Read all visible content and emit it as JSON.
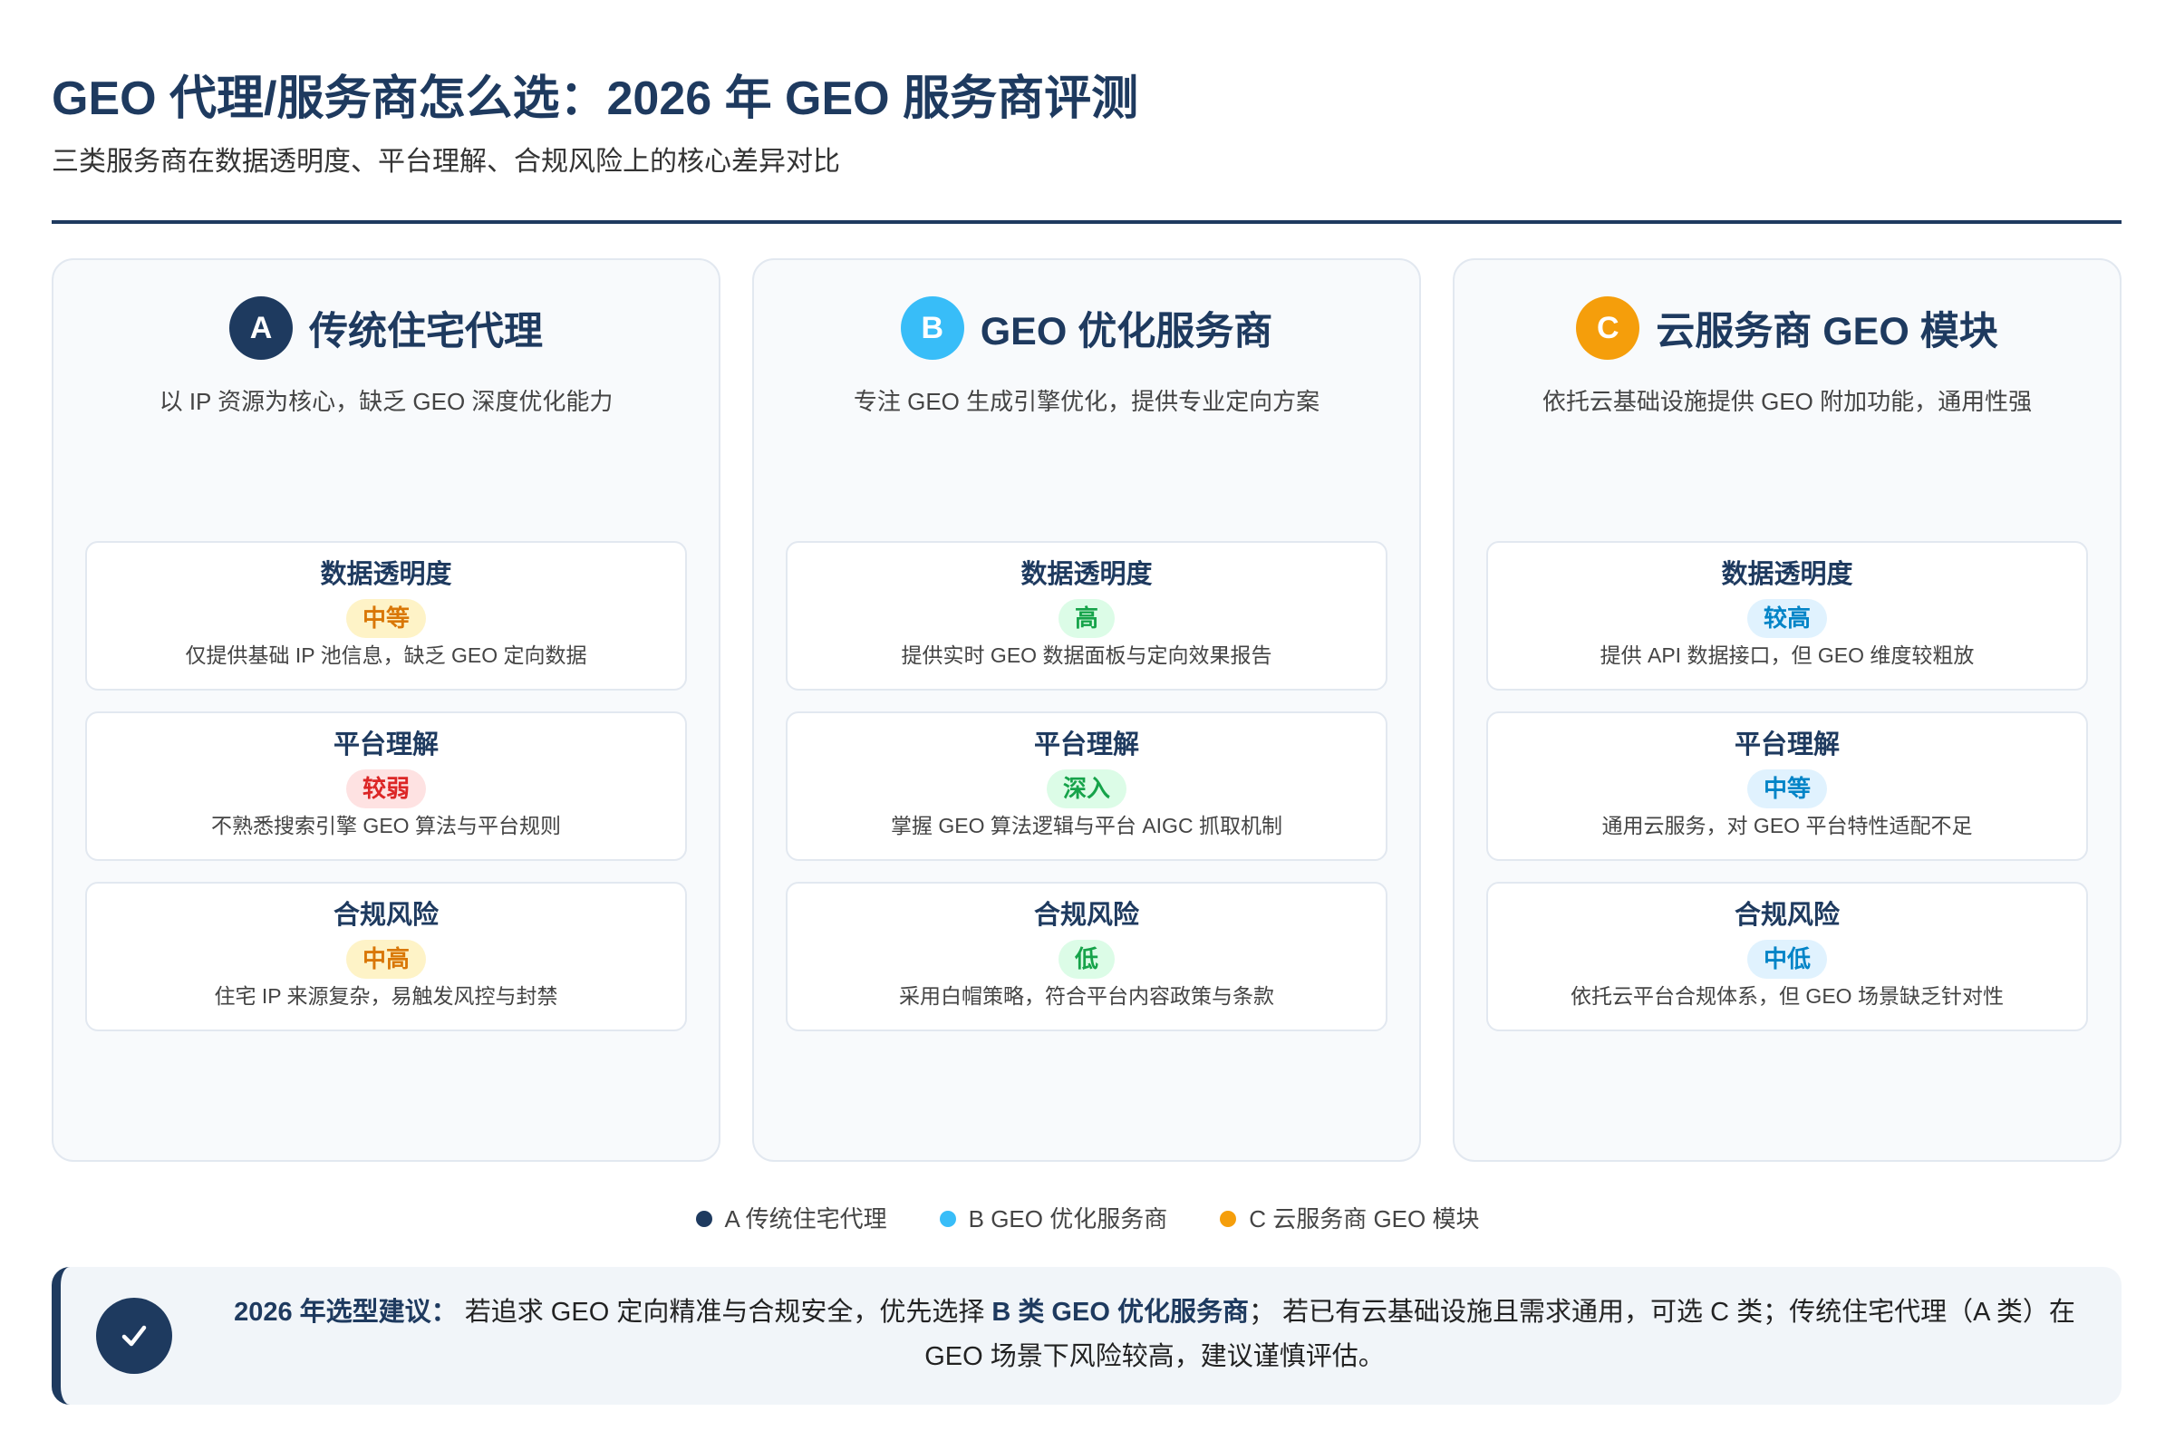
{
  "header": {
    "title": "GEO 代理/服务商怎么选：2026 年 GEO 服务商评测",
    "subtitle": "三类服务商在数据透明度、平台理解、合规风险上的核心差异对比"
  },
  "colors": {
    "primary": "#1e3a5f",
    "rule": "#1e3a5f"
  },
  "cards": [
    {
      "badge": "A",
      "title": "传统住宅代理",
      "description": "以 IP 资源为核心，缺乏 GEO 深度优化能力",
      "accent_color": "#1e3a5f",
      "metrics": [
        {
          "label": "数据透明度",
          "rating": "中等",
          "rating_color": "#d97706",
          "rating_bg": "#fef3c7",
          "note": "仅提供基础 IP 池信息，缺乏 GEO 定向数据"
        },
        {
          "label": "平台理解",
          "rating": "较弱",
          "rating_color": "#dc2626",
          "rating_bg": "#fee2e2",
          "note": "不熟悉搜索引擎 GEO 算法与平台规则"
        },
        {
          "label": "合规风险",
          "rating": "中高",
          "rating_color": "#d97706",
          "rating_bg": "#fef3c7",
          "note": "住宅 IP 来源复杂，易触发风控与封禁"
        }
      ]
    },
    {
      "badge": "B",
      "title": "GEO 优化服务商",
      "description": "专注 GEO 生成引擎优化，提供专业定向方案",
      "accent_color": "#38bdf8",
      "metrics": [
        {
          "label": "数据透明度",
          "rating": "高",
          "rating_color": "#16a34a",
          "rating_bg": "#dcfce7",
          "note": "提供实时 GEO 数据面板与定向效果报告"
        },
        {
          "label": "平台理解",
          "rating": "深入",
          "rating_color": "#16a34a",
          "rating_bg": "#dcfce7",
          "note": "掌握 GEO 算法逻辑与平台 AIGC 抓取机制"
        },
        {
          "label": "合规风险",
          "rating": "低",
          "rating_color": "#16a34a",
          "rating_bg": "#dcfce7",
          "note": "采用白帽策略，符合平台内容政策与条款"
        }
      ]
    },
    {
      "badge": "C",
      "title": "云服务商 GEO 模块",
      "description": "依托云基础设施提供 GEO 附加功能，通用性强",
      "accent_color": "#f59e0b",
      "metrics": [
        {
          "label": "数据透明度",
          "rating": "较高",
          "rating_color": "#0284c7",
          "rating_bg": "#e0f2fe",
          "note": "提供 API 数据接口，但 GEO 维度较粗放"
        },
        {
          "label": "平台理解",
          "rating": "中等",
          "rating_color": "#0284c7",
          "rating_bg": "#e0f2fe",
          "note": "通用云服务，对 GEO 平台特性适配不足"
        },
        {
          "label": "合规风险",
          "rating": "中低",
          "rating_color": "#0284c7",
          "rating_bg": "#e0f2fe",
          "note": "依托云平台合规体系，但 GEO 场景缺乏针对性"
        }
      ]
    }
  ],
  "legend": [
    {
      "label": "A 传统住宅代理",
      "color": "#1e3a5f"
    },
    {
      "label": "B GEO 优化服务商",
      "color": "#38bdf8"
    },
    {
      "label": "C 云服务商 GEO 模块",
      "color": "#f59e0b"
    }
  ],
  "recommendation": {
    "icon": "check-icon",
    "lead": "2026 年选型建议：",
    "text_before": " 若追求 GEO 定向精准与合规安全，优先选择 ",
    "highlight": "B 类 GEO 优化服务商",
    "text_after": "； 若已有云基础设施且需求通用，可选 C 类；传统住宅代理（A 类）在 GEO 场景下风险较高，建议谨慎评估。"
  }
}
